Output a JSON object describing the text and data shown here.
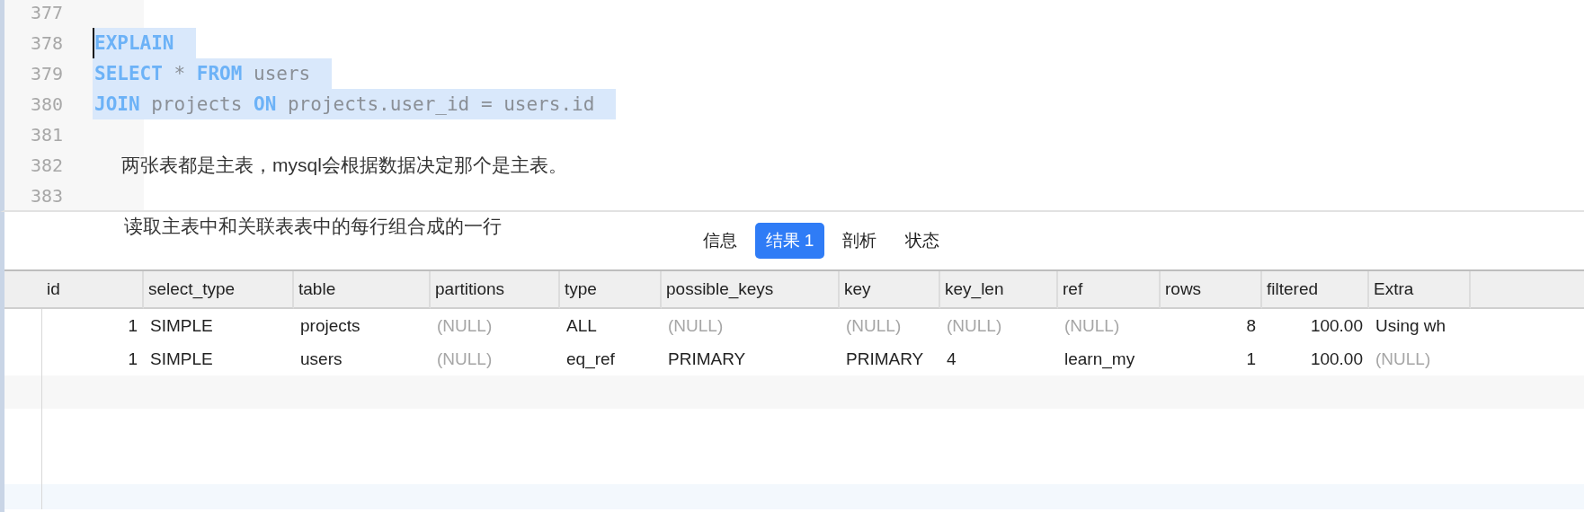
{
  "editor": {
    "lines": [
      {
        "number": "377"
      },
      {
        "number": "378",
        "selected": true,
        "caret": true,
        "tokens": [
          {
            "kind": "keyword",
            "text": "EXPLAIN"
          }
        ]
      },
      {
        "number": "379",
        "selected": true,
        "caret": false,
        "tokens": [
          {
            "kind": "keyword",
            "text": "SELECT"
          },
          {
            "kind": "plain",
            "text": " * "
          },
          {
            "kind": "keyword",
            "text": "FROM"
          },
          {
            "kind": "plain",
            "text": " users"
          }
        ]
      },
      {
        "number": "380",
        "selected": true,
        "caret": false,
        "tokens": [
          {
            "kind": "keyword",
            "text": "JOIN"
          },
          {
            "kind": "plain",
            "text": " projects "
          },
          {
            "kind": "keyword",
            "text": "ON"
          },
          {
            "kind": "plain",
            "text": " projects.user_id = users.id"
          }
        ]
      },
      {
        "number": "381"
      },
      {
        "number": "382",
        "selected": false,
        "caret": false,
        "tokens": [
          {
            "kind": "comment",
            "text": "两张表都是主表，mysql会根据数据决定那个是主表。"
          }
        ]
      },
      {
        "number": "383"
      }
    ],
    "note": "读取主表中和关联表表中的每行组合成的一行"
  },
  "tabs": [
    {
      "label": "信息",
      "selected": false
    },
    {
      "label": "结果 1",
      "selected": true
    },
    {
      "label": "剖析",
      "selected": false
    },
    {
      "label": "状态",
      "selected": false
    }
  ],
  "table": {
    "columns": [
      {
        "label": "id",
        "kind": "number"
      },
      {
        "label": "select_type",
        "kind": "text"
      },
      {
        "label": "table",
        "kind": "text"
      },
      {
        "label": "partitions",
        "kind": "text"
      },
      {
        "label": "type",
        "kind": "text"
      },
      {
        "label": "possible_keys",
        "kind": "text"
      },
      {
        "label": "key",
        "kind": "text"
      },
      {
        "label": "key_len",
        "kind": "text"
      },
      {
        "label": "ref",
        "kind": "text"
      },
      {
        "label": "rows",
        "kind": "number"
      },
      {
        "label": "filtered",
        "kind": "number"
      },
      {
        "label": "Extra",
        "kind": "text"
      }
    ],
    "rows": [
      {
        "cells": [
          {
            "text": "1",
            "null": false
          },
          {
            "text": "SIMPLE",
            "null": false
          },
          {
            "text": "projects",
            "null": false
          },
          {
            "text": "(NULL)",
            "null": true
          },
          {
            "text": "ALL",
            "null": false
          },
          {
            "text": "(NULL)",
            "null": true
          },
          {
            "text": "(NULL)",
            "null": true
          },
          {
            "text": "(NULL)",
            "null": true
          },
          {
            "text": "(NULL)",
            "null": true
          },
          {
            "text": "8",
            "null": false
          },
          {
            "text": "100.00",
            "null": false
          },
          {
            "text": "Using wh",
            "null": false
          }
        ]
      },
      {
        "cells": [
          {
            "text": "1",
            "null": false
          },
          {
            "text": "SIMPLE",
            "null": false
          },
          {
            "text": "users",
            "null": false
          },
          {
            "text": "(NULL)",
            "null": true
          },
          {
            "text": "eq_ref",
            "null": false
          },
          {
            "text": "PRIMARY",
            "null": false
          },
          {
            "text": "PRIMARY",
            "null": false
          },
          {
            "text": "4",
            "null": false
          },
          {
            "text": "learn_my",
            "null": false
          },
          {
            "text": "1",
            "null": false
          },
          {
            "text": "100.00",
            "null": false
          },
          {
            "text": "(NULL)",
            "null": true
          }
        ]
      }
    ]
  }
}
